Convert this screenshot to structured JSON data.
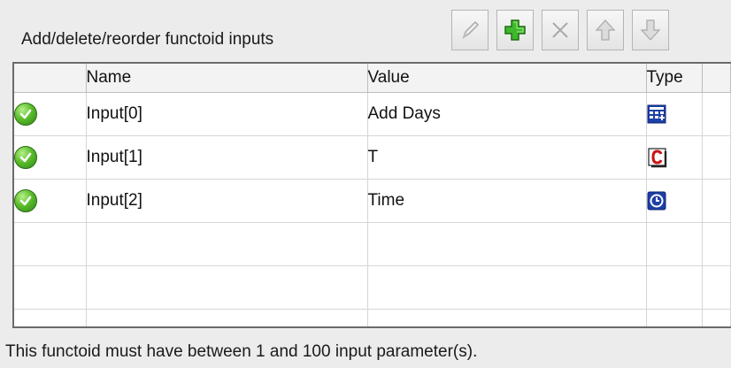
{
  "header": {
    "title": "Add/delete/reorder functoid inputs"
  },
  "toolbar": {
    "buttons": [
      {
        "name": "edit",
        "icon": "pencil-icon",
        "enabled": false
      },
      {
        "name": "add",
        "icon": "plus-icon",
        "enabled": true,
        "color": "#2e9c1e"
      },
      {
        "name": "delete",
        "icon": "delete-x-icon",
        "enabled": false
      },
      {
        "name": "move-up",
        "icon": "arrow-up-icon",
        "enabled": false
      },
      {
        "name": "move-down",
        "icon": "arrow-down-icon",
        "enabled": false
      }
    ]
  },
  "grid": {
    "columns": {
      "name": "Name",
      "value": "Value",
      "type": "Type"
    },
    "rows": [
      {
        "status_icon": "check-icon",
        "name": "Input[0]",
        "value": "Add Days",
        "type_icon": "calculator-icon"
      },
      {
        "status_icon": "check-icon",
        "name": "Input[1]",
        "value": "T",
        "type_icon": "constant-c-icon"
      },
      {
        "status_icon": "check-icon",
        "name": "Input[2]",
        "value": "Time",
        "type_icon": "clock-icon"
      }
    ]
  },
  "footer": {
    "message": "This functoid must have between 1 and 100 input parameter(s)."
  },
  "colors": {
    "accent_green": "#2e9c1e",
    "type_blue": "#1c3fa8",
    "constant_red": "#c81414"
  }
}
